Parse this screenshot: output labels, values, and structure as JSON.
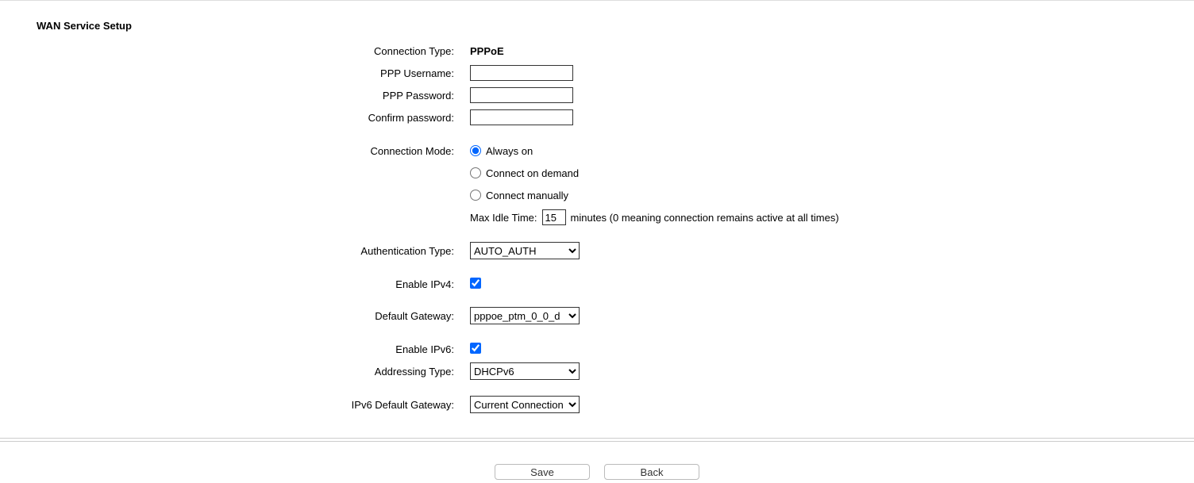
{
  "title": "WAN Service Setup",
  "connectionType": {
    "label": "Connection Type:",
    "value": "PPPoE"
  },
  "pppUsername": {
    "label": "PPP Username:",
    "value": ""
  },
  "pppPassword": {
    "label": "PPP Password:",
    "value": ""
  },
  "confirmPassword": {
    "label": "Confirm password:",
    "value": ""
  },
  "connectionMode": {
    "label": "Connection Mode:",
    "options": {
      "always": "Always on",
      "demand": "Connect on demand",
      "manual": "Connect manually"
    }
  },
  "maxIdle": {
    "prefix": "Max Idle Time:",
    "value": "15",
    "suffix": "minutes (0 meaning connection remains active at all times)"
  },
  "authType": {
    "label": "Authentication Type:",
    "value": "AUTO_AUTH"
  },
  "enableIpv4": {
    "label": "Enable IPv4:"
  },
  "defaultGateway": {
    "label": "Default Gateway:",
    "value": "pppoe_ptm_0_0_d"
  },
  "enableIpv6": {
    "label": "Enable IPv6:"
  },
  "addressingType": {
    "label": "Addressing Type:",
    "value": "DHCPv6"
  },
  "ipv6DefaultGateway": {
    "label": "IPv6 Default Gateway:",
    "value": "Current Connection"
  },
  "buttons": {
    "save": "Save",
    "back": "Back"
  }
}
